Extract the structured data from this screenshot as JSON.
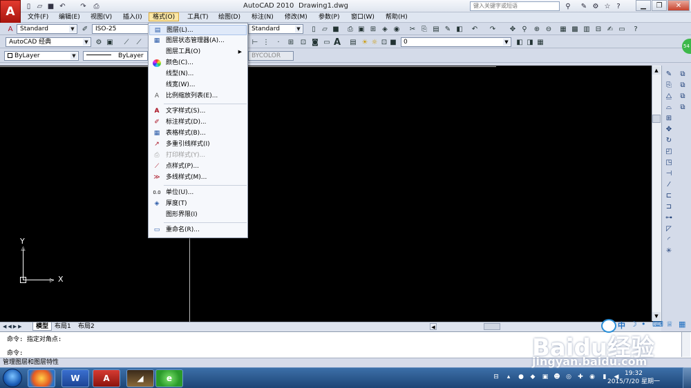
{
  "window": {
    "app_title": "AutoCAD 2010",
    "doc_title": "Drawing1.dwg",
    "search_placeholder": "键入关键字或短语",
    "logo_letter": "A"
  },
  "menu": {
    "items": [
      "文件(F)",
      "编辑(E)",
      "视图(V)",
      "插入(I)",
      "格式(O)",
      "工具(T)",
      "绘图(D)",
      "标注(N)",
      "修改(M)",
      "参数(P)",
      "窗口(W)",
      "帮助(H)"
    ],
    "active_index": 4
  },
  "toolbar": {
    "text_style": "Standard",
    "dim_style": "ISO-25",
    "table_style": "Standard",
    "workspace": "AutoCAD 经典",
    "layer_value": "0",
    "color": "ByLayer",
    "linetype": "ByLayer",
    "plotstyle": "BYCOLOR"
  },
  "format_menu": {
    "items": [
      {
        "label": "图层(L)...",
        "icon": "layers-icon",
        "highlighted": true
      },
      {
        "label": "图层状态管理器(A)...",
        "icon": "layer-state-icon"
      },
      {
        "label": "图层工具(O)",
        "icon": "",
        "submenu": true
      },
      {
        "label": "颜色(C)...",
        "icon": "color-wheel-icon"
      },
      {
        "label": "线型(N)...",
        "icon": ""
      },
      {
        "label": "线宽(W)...",
        "icon": ""
      },
      {
        "label": "比例缩放列表(E)...",
        "icon": "scale-list-icon"
      },
      {
        "label": "文字样式(S)...",
        "icon": "text-style-icon"
      },
      {
        "label": "标注样式(D)...",
        "icon": "dim-style-icon"
      },
      {
        "label": "表格样式(B)...",
        "icon": "table-style-icon"
      },
      {
        "label": "多重引线样式(I)",
        "icon": "mleader-style-icon"
      },
      {
        "label": "打印样式(Y)...",
        "icon": "plot-style-icon",
        "disabled": true
      },
      {
        "label": "点样式(P)...",
        "icon": "point-style-icon"
      },
      {
        "label": "多线样式(M)...",
        "icon": "mline-style-icon"
      },
      {
        "label": "单位(U)...",
        "icon": "units-icon"
      },
      {
        "label": "厚度(T)",
        "icon": "thickness-icon"
      },
      {
        "label": "图形界限(I)",
        "icon": ""
      },
      {
        "label": "重命名(R)...",
        "icon": "rename-icon"
      }
    ]
  },
  "canvas": {
    "ucs_y": "Y",
    "ucs_x": "X"
  },
  "layout_tabs": [
    "模型",
    "布局1",
    "布局2"
  ],
  "layout_active_index": 0,
  "command": {
    "line1": "命令: 指定对角点:",
    "line2": "命令:"
  },
  "status": {
    "text": "管理图层和图层特性"
  },
  "taskbar": {
    "time": "19:32",
    "date": "2015/7/20 星期一",
    "ime_label": "中"
  },
  "watermark": {
    "brand": "Baidu经验",
    "url": "jingyan.baidu.com"
  },
  "colors": {
    "canvas": "#000000",
    "menu_active": "#fbe7a6",
    "highlight": "#dfe9f9"
  }
}
